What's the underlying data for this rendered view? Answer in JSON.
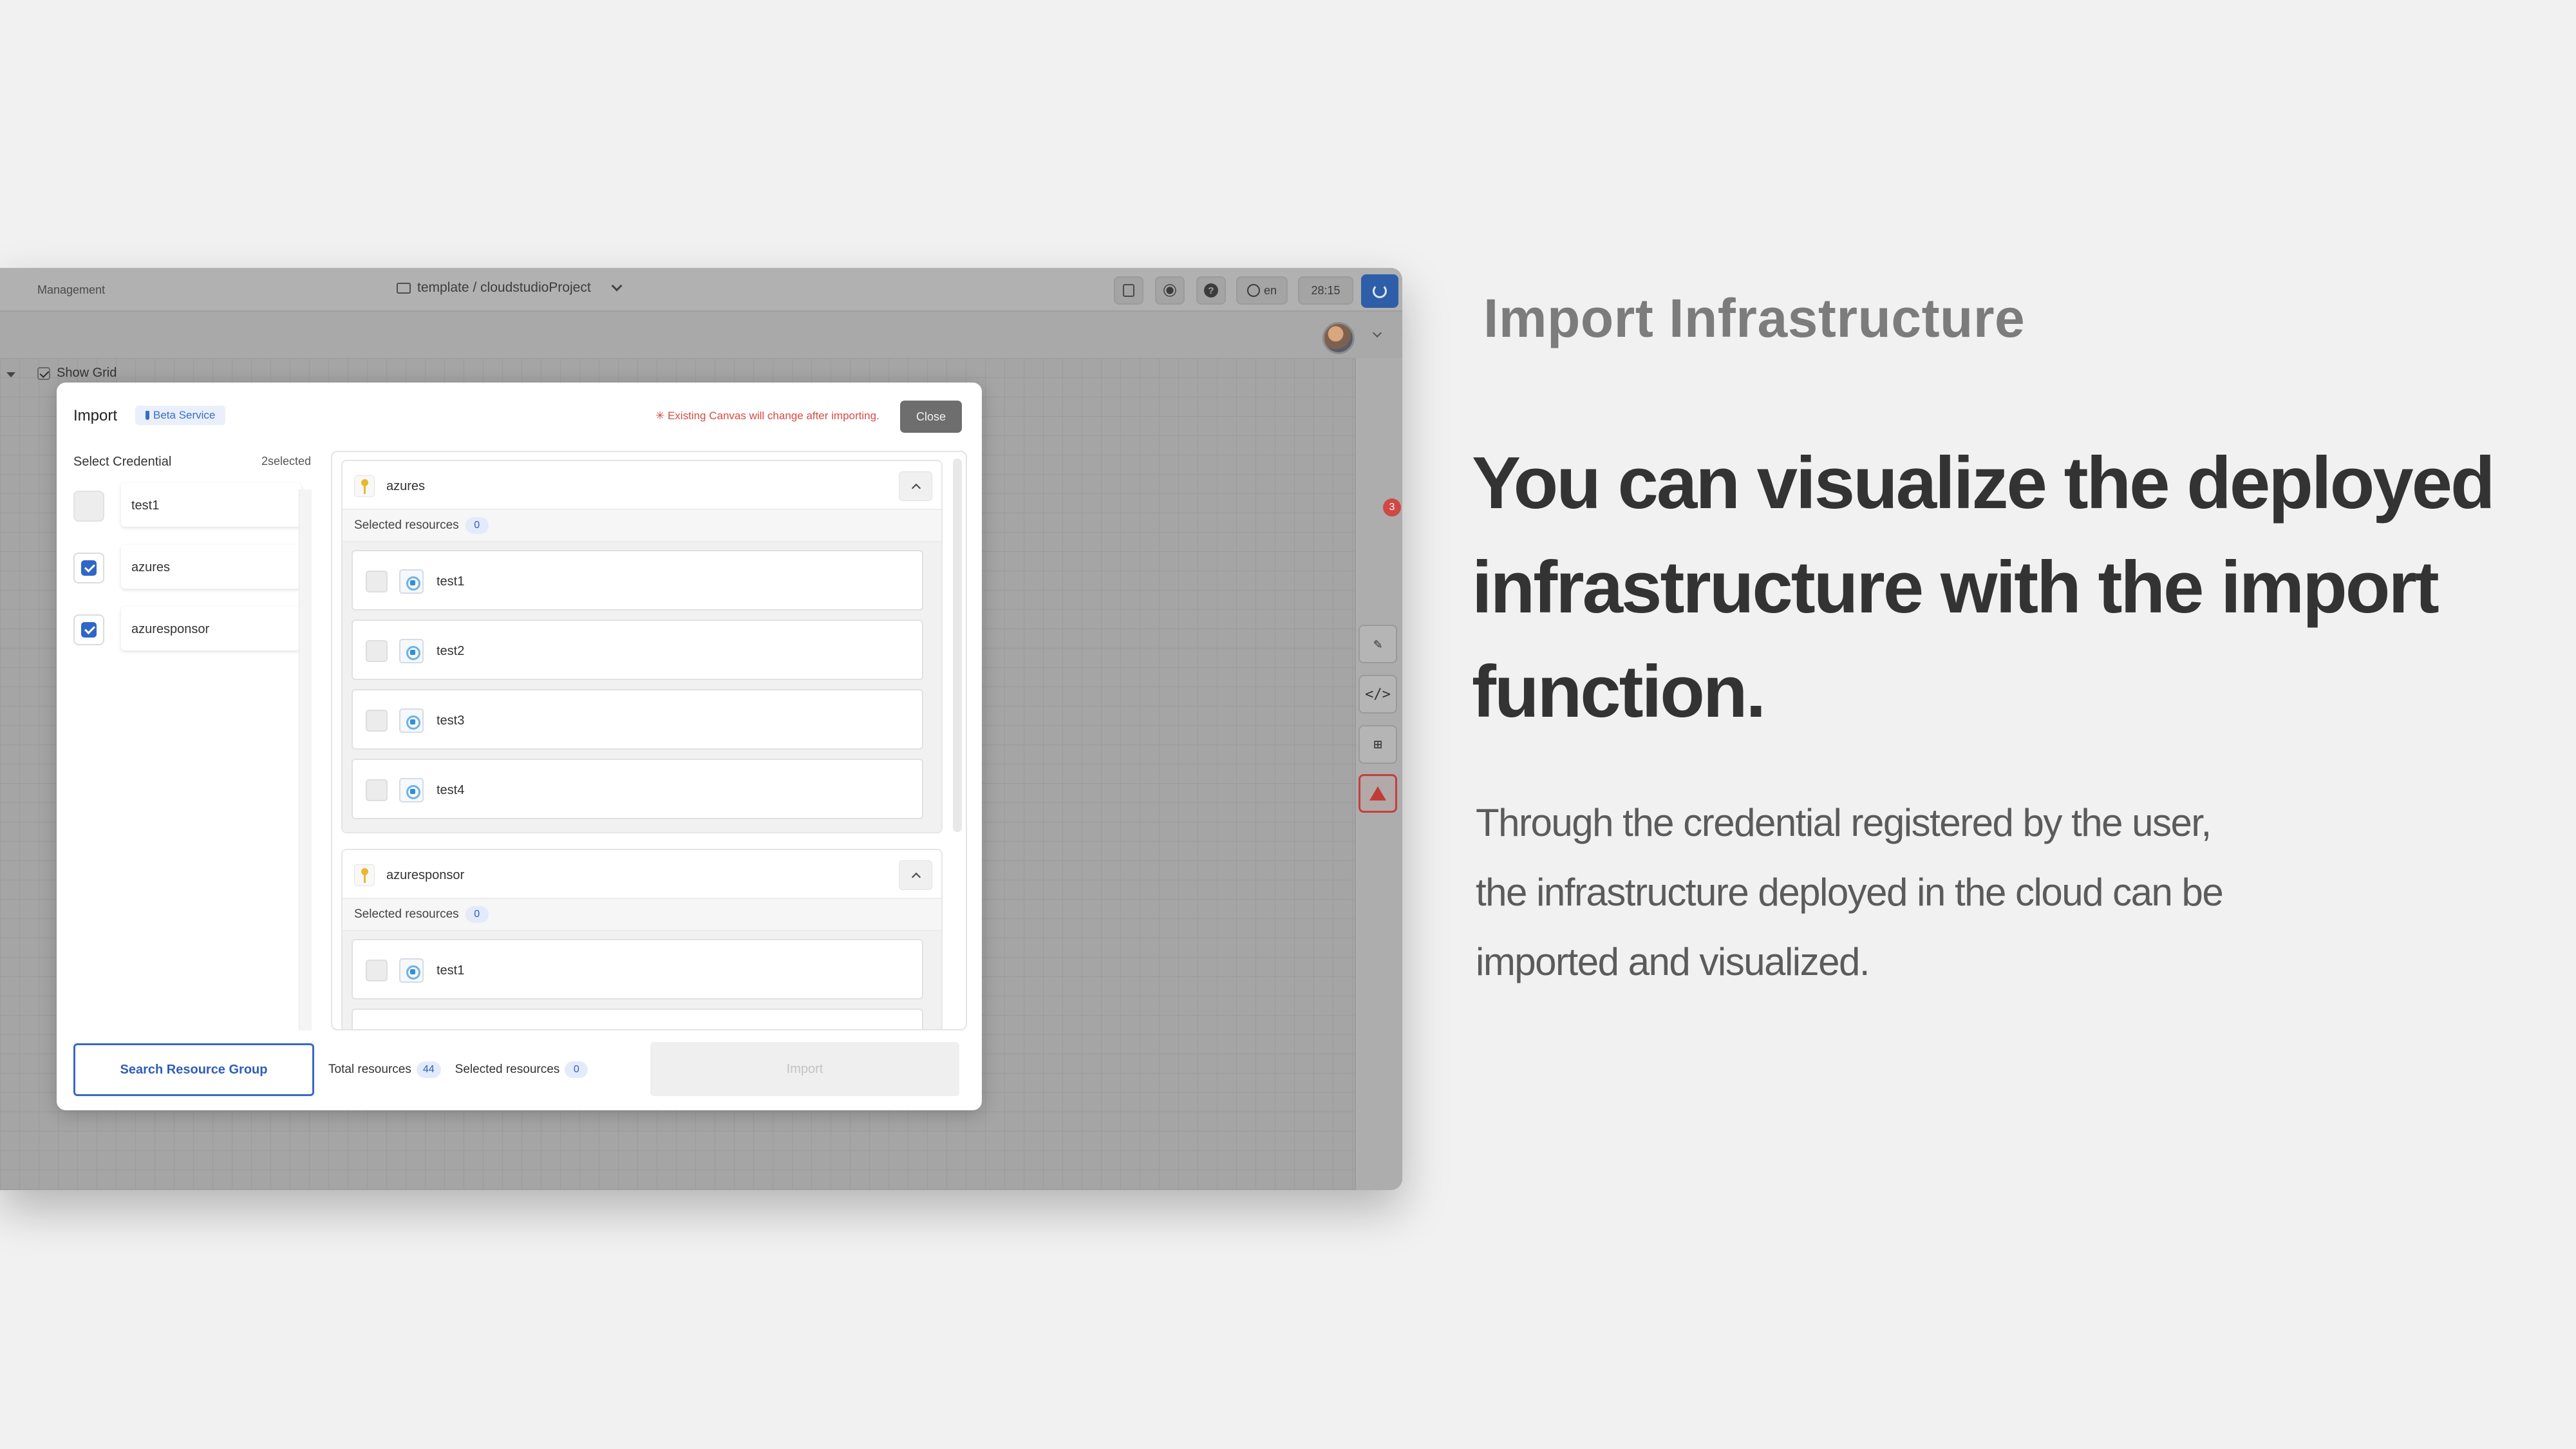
{
  "topbar": {
    "management": "Management",
    "project_path": "template / cloudstudioProject",
    "language": "en",
    "timer": "28:15"
  },
  "canvas": {
    "show_grid_label": "Show Grid"
  },
  "rail": {
    "warning_count": "3"
  },
  "modal": {
    "title": "Import",
    "beta_badge": "Beta Service",
    "warning": "✳ Existing Canvas will change after importing.",
    "close_label": "Close",
    "credentials_header": "Select Credential",
    "credentials_selected": "2selected",
    "credentials": [
      {
        "label": "test1",
        "checked": false
      },
      {
        "label": "azures",
        "checked": true
      },
      {
        "label": "azuresponsor",
        "checked": true
      }
    ],
    "groups": [
      {
        "name": "azures",
        "selected_label": "Selected resources",
        "selected_count": "0",
        "items": [
          "test1",
          "test2",
          "test3",
          "test4"
        ]
      },
      {
        "name": "azuresponsor",
        "selected_label": "Selected resources",
        "selected_count": "0",
        "items": [
          "test1"
        ]
      }
    ],
    "footer": {
      "search_label": "Search Resource Group",
      "total_label": "Total resources",
      "total_count": "44",
      "selected_label": "Selected resources",
      "selected_count": "0",
      "import_label": "Import"
    }
  },
  "marketing": {
    "eyebrow": "Import Infrastructure",
    "headline": "You can visualize the deployed infrastructure with the import function.",
    "body_lines": [
      "Through the credential registered by the user,",
      "the infrastructure deployed in the cloud can be",
      "imported and visualized."
    ]
  },
  "colors": {
    "accent": "#2f66c8",
    "warning": "#d64b45",
    "key_icon": "#e9b92a"
  }
}
